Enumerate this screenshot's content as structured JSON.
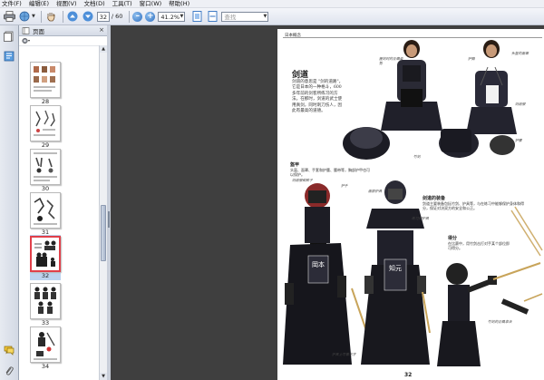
{
  "menu": [
    "文件(F)",
    "编辑(E)",
    "视图(V)",
    "文档(D)",
    "工具(T)",
    "窗口(W)",
    "帮助(H)"
  ],
  "toolbar": {
    "current_page": "32",
    "total_pages": "/ 60",
    "zoom": "41.2%",
    "search_placeholder": "查找"
  },
  "panel": {
    "title": "页面"
  },
  "thumbnails": [
    {
      "label": "28"
    },
    {
      "label": "29"
    },
    {
      "label": "30"
    },
    {
      "label": "31"
    },
    {
      "label": "32",
      "selected": true
    },
    {
      "label": "33"
    },
    {
      "label": "34"
    }
  ],
  "doc": {
    "header": "日本概念",
    "title": "剑道",
    "intro": "剑道的意思是 \"剑的道路\"，它是日本的一种格斗，600多年前的剑客所练习的方法。在那时，剑道的武士使用真剑，同时刺刀伤人，因此有最高的道德。",
    "section_armor_label": "盔甲",
    "armor_text": "头盔、面罩、手套和护腰、腰带等，胸部护甲也可以保护。",
    "section_sword_label": "剑道的装备",
    "sword_text": "剑道主要装备包括竹剑、护具等，与在练习中能够保护身体和得分，保证对决双方的安全和公正。",
    "section_score_label": "得分",
    "score_text": "在比赛中，用竹剑击打对手某个部位即可得分。",
    "captions": [
      "握剑时的正确姿势",
      "头盔的面罩",
      "护胸",
      "剑道服",
      "竹剑",
      "护腰",
      "剑道服和裤子",
      "护手",
      "面部护具",
      "练习用护具",
      "护具上写着名字",
      "竹剑的正确拿法"
    ],
    "name_badge_1": "岡本",
    "name_badge_2": "知元",
    "page_number": "32"
  },
  "colors": {
    "doc_bg": "#3f3f3f",
    "selected_border": "#e0404a",
    "selected_bg": "#bcd3ef",
    "accent_blue": "#2f6fbf"
  }
}
